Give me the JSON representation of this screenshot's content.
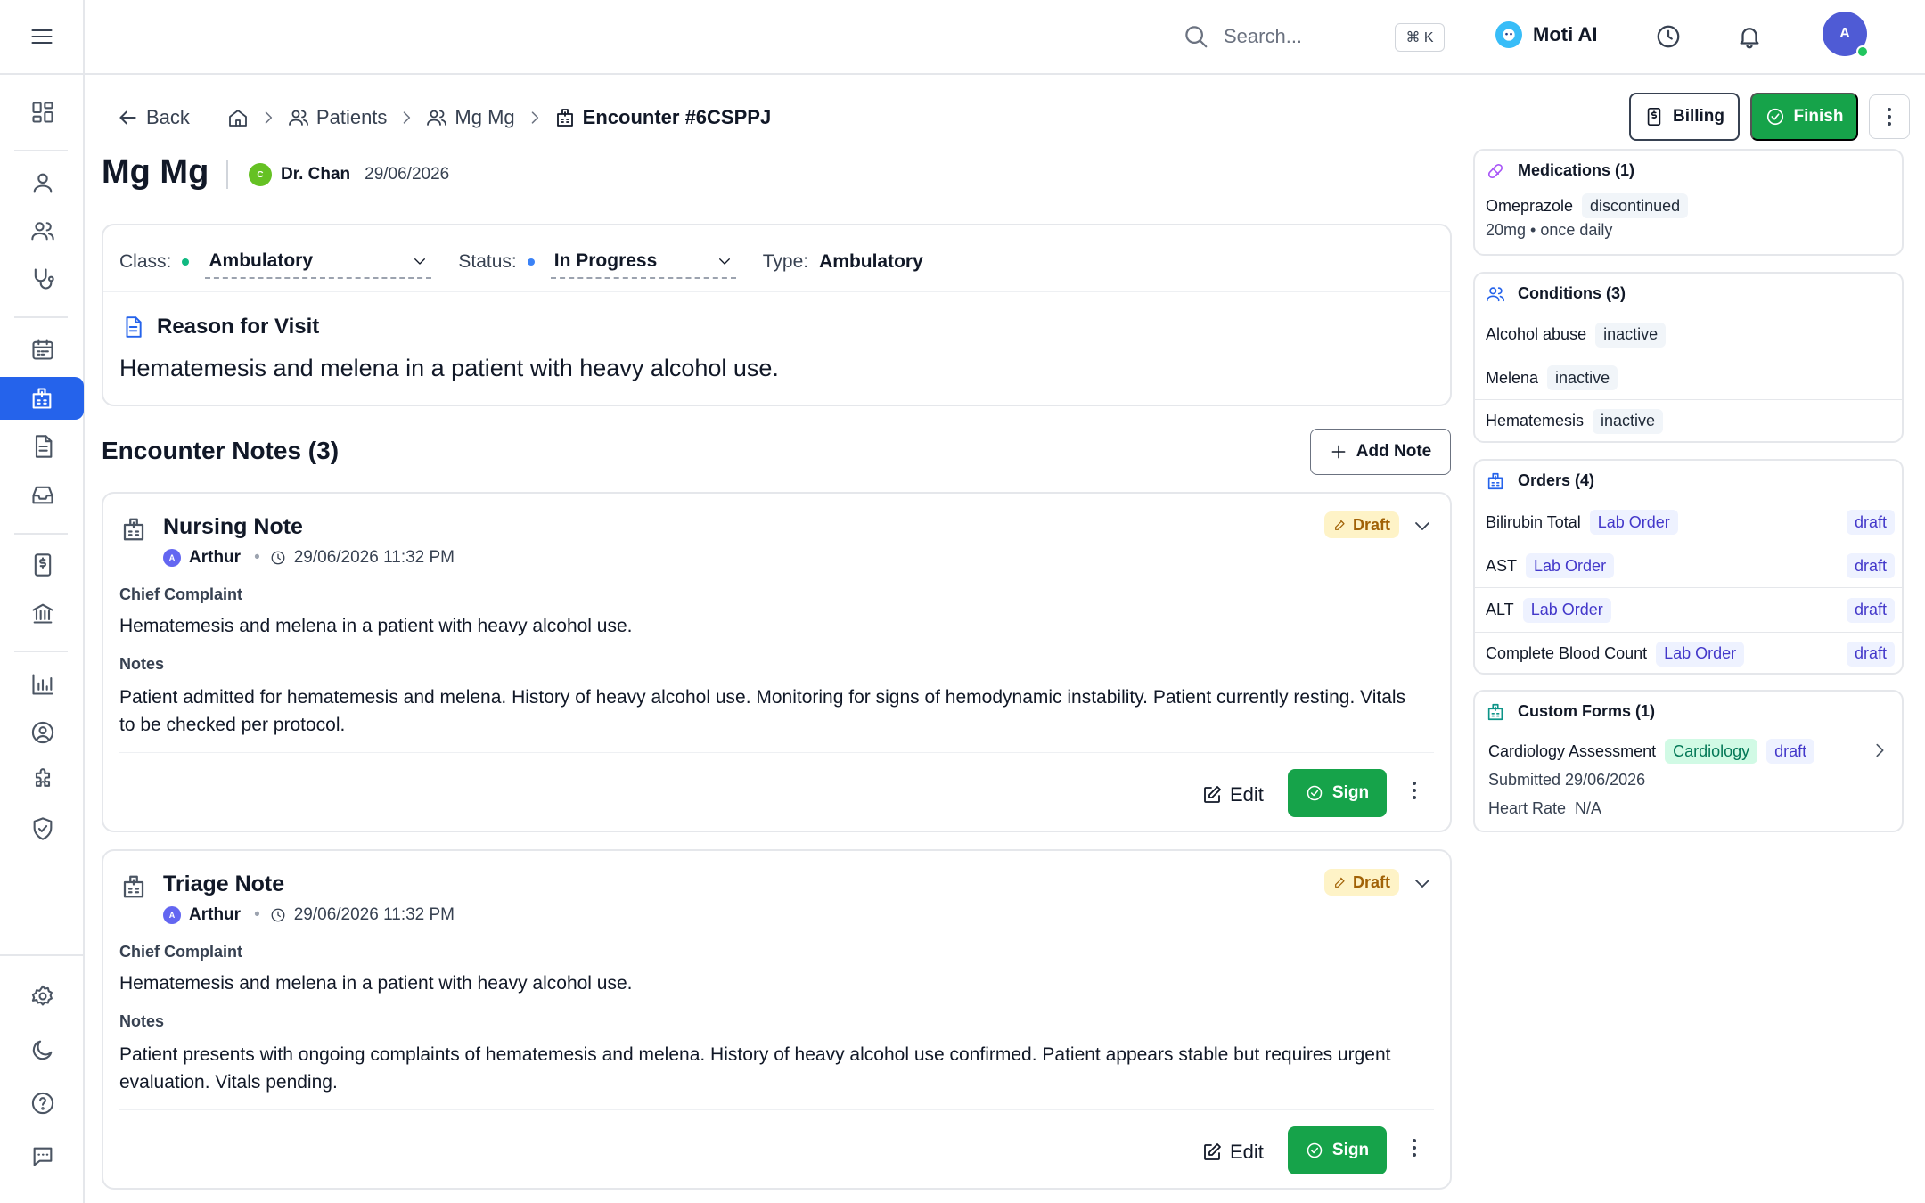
{
  "topbar": {
    "search_placeholder": "Search...",
    "shortcut": "⌘ K",
    "ai_label": "Moti AI",
    "avatar_initial": "A"
  },
  "breadcrumb": {
    "back": "Back",
    "patients": "Patients",
    "patient": "Mg Mg",
    "encounter": "Encounter #6CSPPJ"
  },
  "actions": {
    "billing": "Billing",
    "finish": "Finish"
  },
  "patient": {
    "name": "Mg Mg",
    "doctor_initial": "C",
    "doctor": "Dr. Chan",
    "date": "29/06/2026"
  },
  "encounter": {
    "class_label": "Class:",
    "class_value": "Ambulatory",
    "status_label": "Status:",
    "status_value": "In Progress",
    "type_label": "Type:",
    "type_value": "Ambulatory",
    "reason_title": "Reason for Visit",
    "reason_text": "Hematemesis and melena in a patient with heavy alcohol use.",
    "class_color": "#10b981",
    "status_color": "#3b82f6"
  },
  "notes": {
    "heading": "Encounter Notes (3)",
    "add_label": "Add Note",
    "items": [
      {
        "title": "Nursing Note",
        "author_initial": "A",
        "author": "Arthur",
        "time": "29/06/2026 11:32 PM",
        "status": "Draft",
        "cc_label": "Chief Complaint",
        "cc_text": "Hematemesis and melena in a patient with heavy alcohol use.",
        "notes_label": "Notes",
        "notes_text": "Patient admitted for hematemesis and melena. History of heavy alcohol use. Monitoring for signs of hemodynamic instability. Patient currently resting. Vitals to be checked per protocol.",
        "edit": "Edit",
        "sign": "Sign"
      },
      {
        "title": "Triage Note",
        "author_initial": "A",
        "author": "Arthur",
        "time": "29/06/2026 11:32 PM",
        "status": "Draft",
        "cc_label": "Chief Complaint",
        "cc_text": "Hematemesis and melena in a patient with heavy alcohol use.",
        "notes_label": "Notes",
        "notes_text": "Patient presents with ongoing complaints of hematemesis and melena. History of heavy alcohol use confirmed. Patient appears stable but requires urgent evaluation. Vitals pending.",
        "edit": "Edit",
        "sign": "Sign"
      }
    ]
  },
  "medications": {
    "title": "Medications (1)",
    "items": [
      {
        "name": "Omeprazole",
        "status": "discontinued",
        "detail": "20mg • once daily"
      }
    ]
  },
  "conditions": {
    "title": "Conditions (3)",
    "items": [
      {
        "name": "Alcohol abuse",
        "status": "inactive"
      },
      {
        "name": "Melena",
        "status": "inactive"
      },
      {
        "name": "Hematemesis",
        "status": "inactive"
      }
    ]
  },
  "orders": {
    "title": "Orders (4)",
    "items": [
      {
        "name": "Bilirubin Total",
        "type": "Lab Order",
        "status": "draft"
      },
      {
        "name": "AST",
        "type": "Lab Order",
        "status": "draft"
      },
      {
        "name": "ALT",
        "type": "Lab Order",
        "status": "draft"
      },
      {
        "name": "Complete Blood Count",
        "type": "Lab Order",
        "status": "draft"
      }
    ]
  },
  "custom_forms": {
    "title": "Custom Forms (1)",
    "items": [
      {
        "name": "Cardiology Assessment",
        "category": "Cardiology",
        "status": "draft",
        "submitted": "Submitted 29/06/2026",
        "field_label": "Heart Rate",
        "field_value": "N/A"
      }
    ]
  },
  "colors": {
    "primary": "#2563eb",
    "success": "#16a34a",
    "draft_bg": "#fef3c7",
    "draft_text": "#a16207"
  }
}
